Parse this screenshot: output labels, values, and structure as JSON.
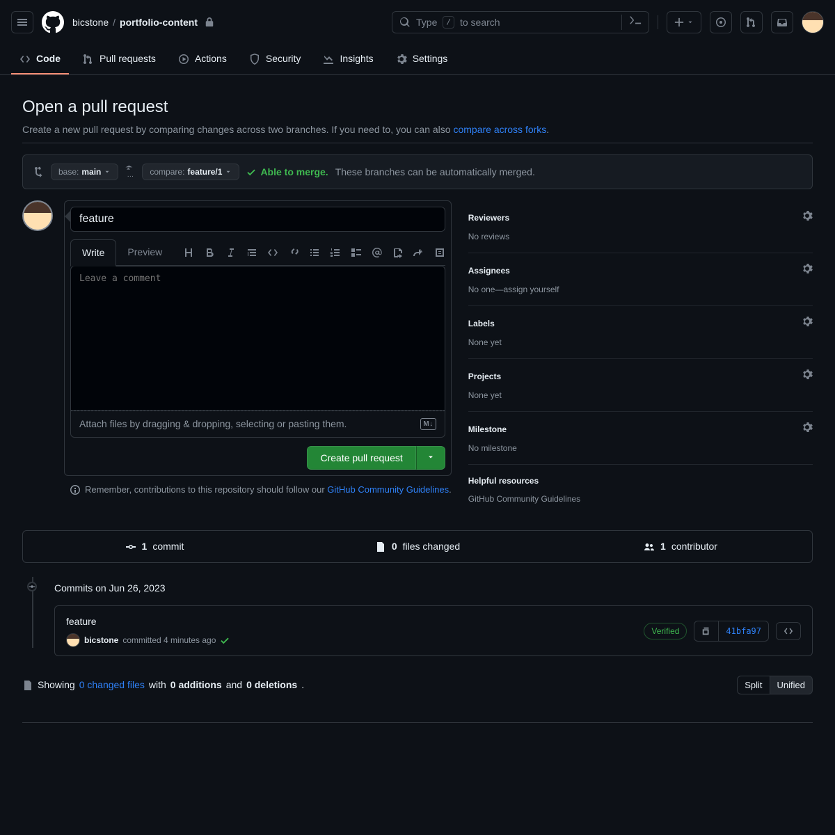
{
  "header": {
    "owner": "bicstone",
    "repo": "portfolio-content",
    "search_prefix": "Type",
    "search_key": "/",
    "search_suffix": "to search"
  },
  "nav": {
    "code": "Code",
    "pull_requests": "Pull requests",
    "actions": "Actions",
    "security": "Security",
    "insights": "Insights",
    "settings": "Settings"
  },
  "page": {
    "title": "Open a pull request",
    "subtitle_pre": "Create a new pull request by comparing changes across two branches. If you need to, you can also ",
    "subtitle_link": "compare across forks",
    "subtitle_post": "."
  },
  "range": {
    "base_label": "base:",
    "base_branch": "main",
    "swap": "…",
    "compare_label": "compare:",
    "compare_branch": "feature/1",
    "able": "Able to merge.",
    "able_msg": "These branches can be automatically merged."
  },
  "form": {
    "title_value": "feature",
    "tab_write": "Write",
    "tab_preview": "Preview",
    "comment_placeholder": "Leave a comment",
    "attach": "Attach files by dragging & dropping, selecting or pasting them.",
    "submit": "Create pull request",
    "guidelines_pre": "Remember, contributions to this repository should follow our ",
    "guidelines_link": "GitHub Community Guidelines",
    "guidelines_post": "."
  },
  "sidebar": {
    "reviewers": {
      "title": "Reviewers",
      "value": "No reviews"
    },
    "assignees": {
      "title": "Assignees",
      "value_pre": "No one—",
      "value_link": "assign yourself"
    },
    "labels": {
      "title": "Labels",
      "value": "None yet"
    },
    "projects": {
      "title": "Projects",
      "value": "None yet"
    },
    "milestone": {
      "title": "Milestone",
      "value": "No milestone"
    },
    "help": {
      "title": "Helpful resources",
      "value": "GitHub Community Guidelines"
    }
  },
  "stats": {
    "commits_num": "1",
    "commits_label": "commit",
    "files_num": "0",
    "files_label": "files changed",
    "contrib_num": "1",
    "contrib_label": "contributor"
  },
  "commits": {
    "group_label": "Commits on Jun 26, 2023",
    "row": {
      "title": "feature",
      "author": "bicstone",
      "meta": "committed 4 minutes ago",
      "verified": "Verified",
      "sha": "41bfa97"
    }
  },
  "diff": {
    "showing": "Showing",
    "changed_files_link": "0 changed files",
    "with": "with",
    "additions": "0 additions",
    "and": "and",
    "deletions": "0 deletions",
    "split": "Split",
    "unified": "Unified"
  }
}
